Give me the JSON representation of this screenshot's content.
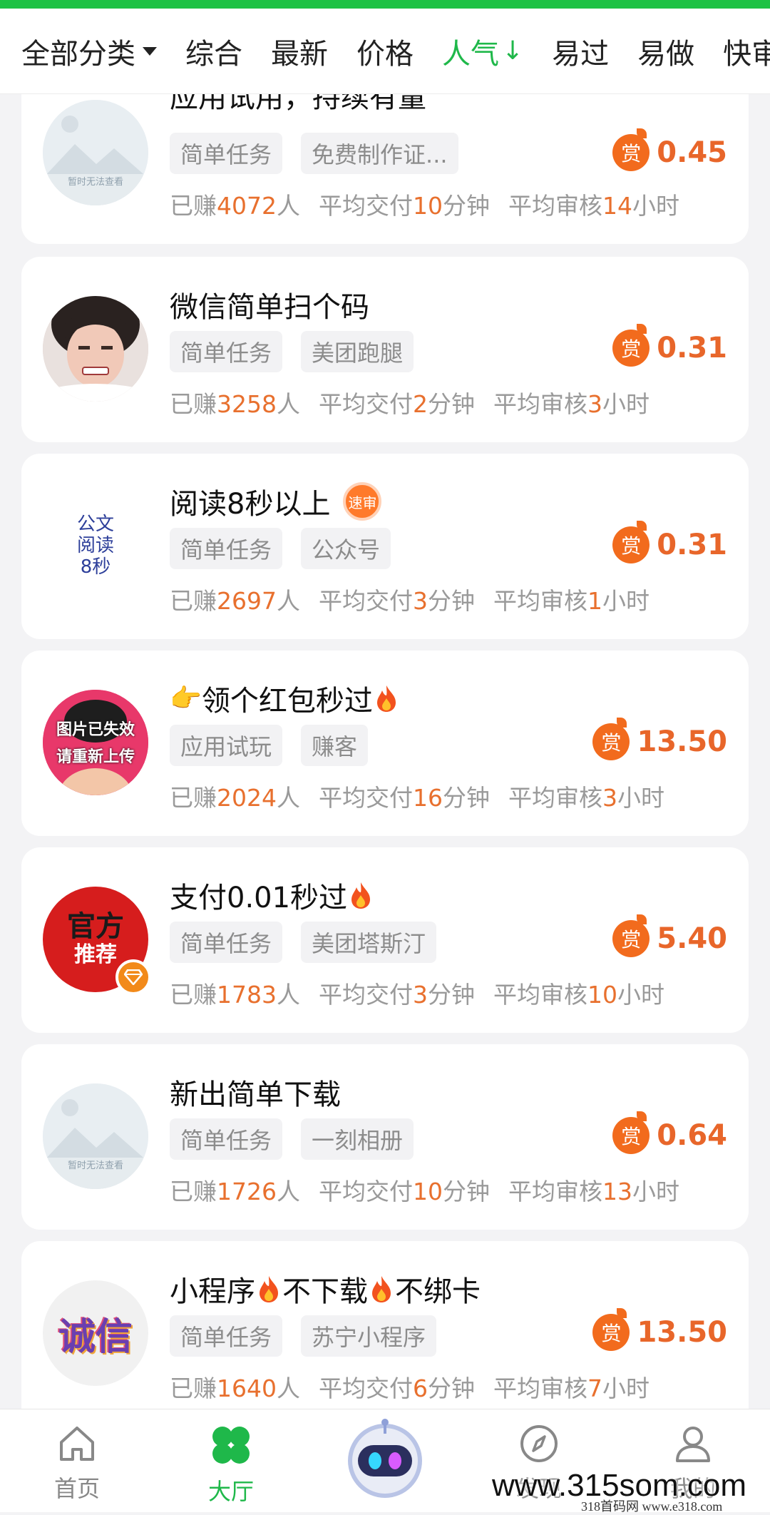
{
  "filters": [
    {
      "label": "全部分类",
      "dropdown": true,
      "active": false
    },
    {
      "label": "综合",
      "active": false
    },
    {
      "label": "最新",
      "active": false
    },
    {
      "label": "价格",
      "active": false
    },
    {
      "label": "人气",
      "arrow": "↓",
      "active": true
    },
    {
      "label": "易过",
      "active": false
    },
    {
      "label": "易做",
      "active": false
    },
    {
      "label": "快审",
      "active": false
    }
  ],
  "tasks": [
    {
      "title": "应用试用，持续有量",
      "avatar_text": "暂时无法查看",
      "tags": [
        "简单任务",
        "免费制作证..."
      ],
      "reward": "0.45",
      "earned": "4072",
      "delivery": "10",
      "review": "14"
    },
    {
      "title": "微信简单扫个码",
      "tags": [
        "简单任务",
        "美团跑腿"
      ],
      "reward": "0.31",
      "earned": "3258",
      "delivery": "2",
      "review": "3"
    },
    {
      "title": "阅读8秒以上",
      "badge": "速审",
      "avatar_lines": [
        "公文",
        "阅读",
        "8秒"
      ],
      "tags": [
        "简单任务",
        "公众号"
      ],
      "reward": "0.31",
      "earned": "2697",
      "delivery": "3",
      "review": "1"
    },
    {
      "title_parts": [
        "领个红包秒过"
      ],
      "avatar_lines": [
        "图片已失效",
        "请重新上传"
      ],
      "tags": [
        "应用试玩",
        "赚客"
      ],
      "reward": "13.50",
      "earned": "2024",
      "delivery": "16",
      "review": "3"
    },
    {
      "title_parts": [
        "支付0.01秒过"
      ],
      "avatar_lines": [
        "官方",
        "推荐"
      ],
      "tags": [
        "简单任务",
        "美团塔斯汀"
      ],
      "reward": "5.40",
      "earned": "1783",
      "delivery": "3",
      "review": "10"
    },
    {
      "title": "新出简单下载",
      "avatar_text": "暂时无法查看",
      "tags": [
        "简单任务",
        "一刻相册"
      ],
      "reward": "0.64",
      "earned": "1726",
      "delivery": "10",
      "review": "13"
    },
    {
      "title_parts": [
        "小程序",
        "不下载",
        "不绑卡"
      ],
      "avatar_lines": [
        "诚信"
      ],
      "tags": [
        "简单任务",
        "苏宁小程序"
      ],
      "reward": "13.50",
      "earned": "1640",
      "delivery": "6",
      "review": "7"
    }
  ],
  "stat_labels": {
    "earned_prefix": "已赚",
    "earned_suffix": "人",
    "delivery_prefix": "平均交付",
    "delivery_suffix": "分钟",
    "review_prefix": "平均审核",
    "review_suffix": "小时"
  },
  "reward_icon": "赏",
  "nav": [
    {
      "label": "首页",
      "icon": "home-icon"
    },
    {
      "label": "大厅",
      "icon": "clover-icon",
      "active": true
    },
    {
      "label": "",
      "icon": "robot-icon"
    },
    {
      "label": "发现",
      "icon": "compass-icon"
    },
    {
      "label": "我的",
      "icon": "user-icon"
    }
  ],
  "watermark": "www.315som.com",
  "watermark_small": "318首码网  www.e318.com",
  "colors": {
    "accent_green": "#1fb84a",
    "reward_orange": "#e8662a",
    "top_bar": "#1ec244"
  }
}
